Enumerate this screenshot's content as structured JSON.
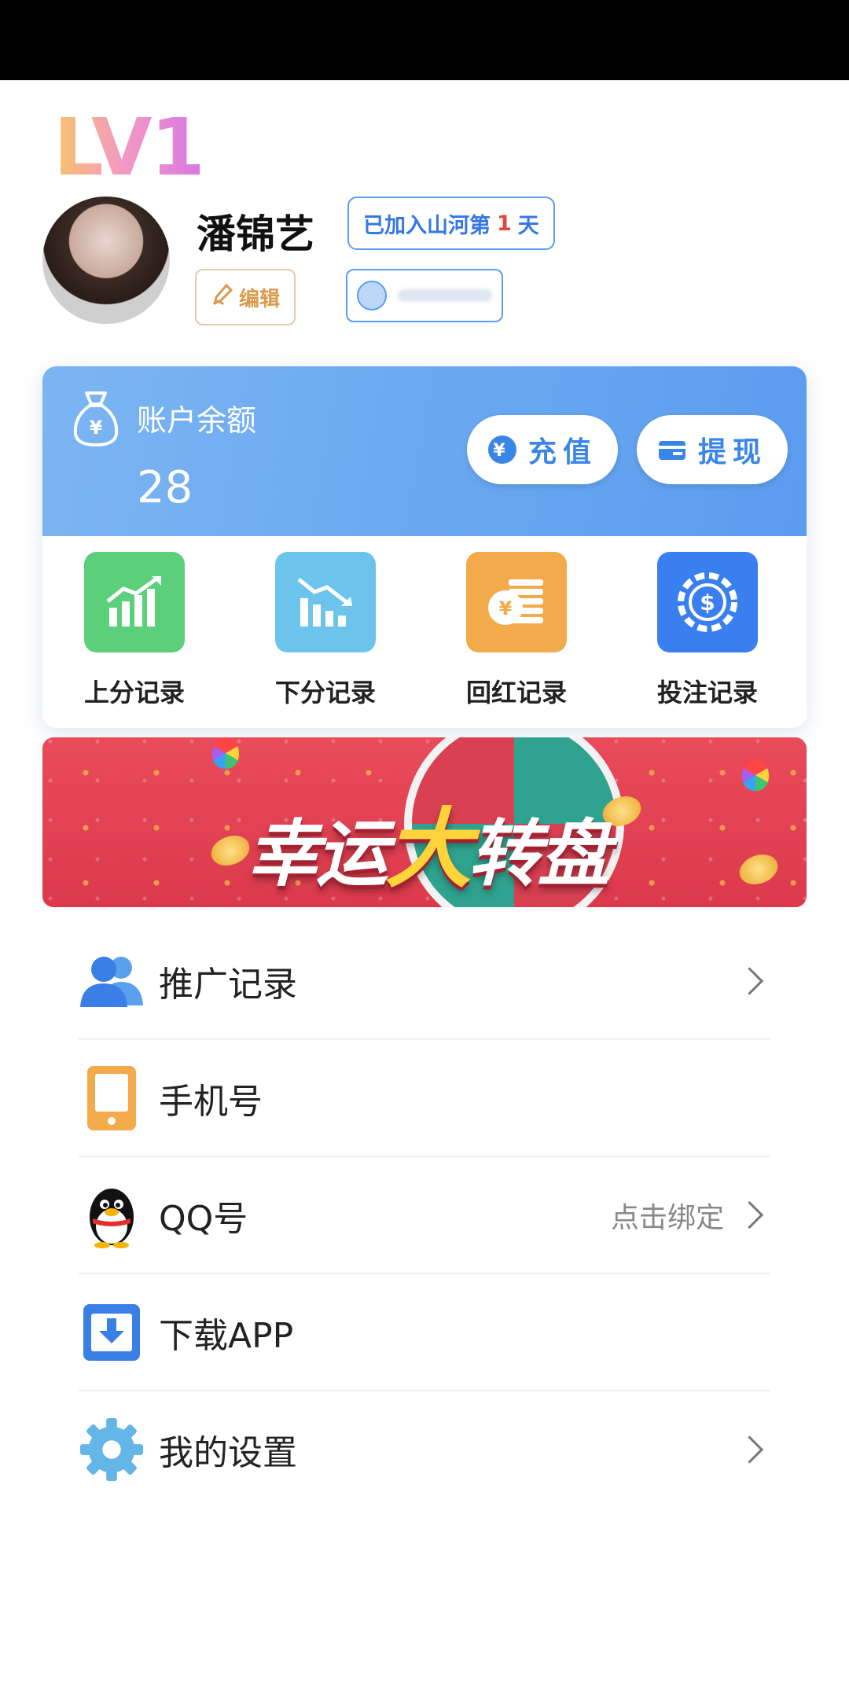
{
  "status_bar": {},
  "profile": {
    "level": "LV1",
    "username": "潘锦艺",
    "joined_prefix": "已加入山河第",
    "joined_days": "1",
    "joined_suffix": "天",
    "edit_label": "编辑"
  },
  "balance": {
    "label": "账户余额",
    "value": "28",
    "recharge_label": "充值",
    "withdraw_label": "提现"
  },
  "records": [
    {
      "label": "上分记录",
      "color": "#5ccf7a",
      "icon": "chart-up-icon"
    },
    {
      "label": "下分记录",
      "color": "#6cc4ec",
      "icon": "chart-down-icon"
    },
    {
      "label": "回红记录",
      "color": "#f2aa4a",
      "icon": "coins-icon"
    },
    {
      "label": "投注记录",
      "color": "#3a7ff0",
      "icon": "chip-icon"
    }
  ],
  "banner": {
    "title_part1": "幸运",
    "title_big": "大",
    "title_part2": "转盘"
  },
  "menu": [
    {
      "label": "推广记录",
      "icon": "users-icon",
      "hint": "",
      "chevron": true
    },
    {
      "label": "手机号",
      "icon": "phone-icon",
      "hint": "",
      "chevron": false
    },
    {
      "label": "QQ号",
      "icon": "qq-penguin-icon",
      "hint": "点击绑定",
      "chevron": true
    },
    {
      "label": "下载APP",
      "icon": "download-icon",
      "hint": "",
      "chevron": false
    },
    {
      "label": "我的设置",
      "icon": "gear-icon",
      "hint": "",
      "chevron": true
    }
  ]
}
